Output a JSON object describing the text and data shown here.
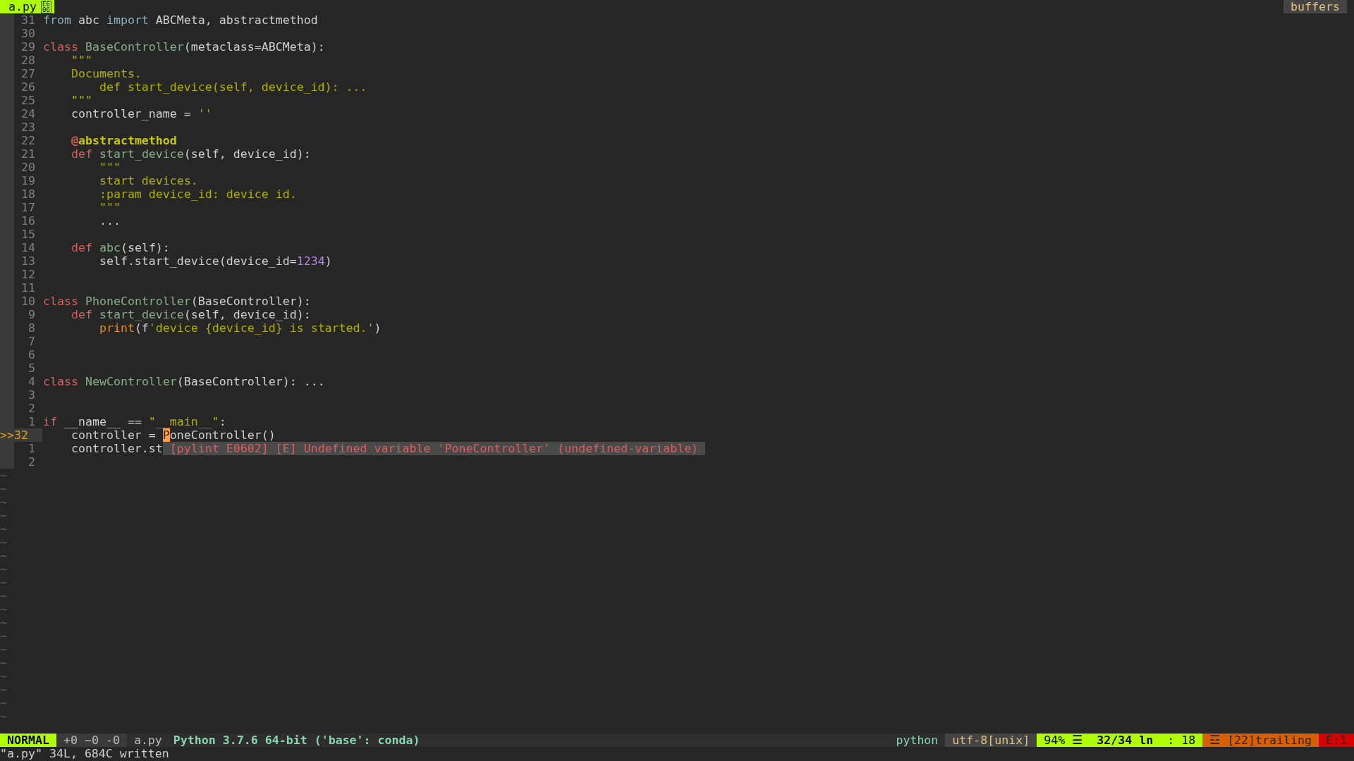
{
  "tabline": {
    "tabs": [
      {
        "label": "a.py",
        "selected": true,
        "glyph": [
          "E6",
          "06"
        ]
      }
    ],
    "right_label": "buffers"
  },
  "lines": [
    {
      "number": "31",
      "current": false,
      "segments": [
        {
          "kind": "import",
          "text": "from"
        },
        {
          "kind": "plain",
          "text": " abc "
        },
        {
          "kind": "import",
          "text": "import"
        },
        {
          "kind": "plain",
          "text": " ABCMeta, abstractmethod"
        }
      ]
    },
    {
      "number": "30",
      "current": false
    },
    {
      "number": "29",
      "current": false,
      "segments": [
        {
          "kind": "keyword",
          "text": "class "
        },
        {
          "kind": "name",
          "text": "BaseController"
        },
        {
          "kind": "plain",
          "text": "(metaclass=ABCMeta):"
        }
      ]
    },
    {
      "number": "28",
      "current": false,
      "segments": [
        {
          "kind": "string",
          "text": "    \"\"\""
        }
      ]
    },
    {
      "number": "27",
      "current": false,
      "segments": [
        {
          "kind": "string",
          "text": "    Documents."
        }
      ]
    },
    {
      "number": "26",
      "current": false,
      "segments": [
        {
          "kind": "string",
          "text": "        def start_device(self, device_id): ..."
        }
      ]
    },
    {
      "number": "25",
      "current": false,
      "segments": [
        {
          "kind": "string",
          "text": "    \"\"\""
        }
      ]
    },
    {
      "number": "24",
      "current": false,
      "segments": [
        {
          "kind": "plain",
          "text": "    controller_name = "
        },
        {
          "kind": "string",
          "text": "''"
        }
      ]
    },
    {
      "number": "23",
      "current": false
    },
    {
      "number": "22",
      "current": false,
      "segments": [
        {
          "kind": "decorator_mark",
          "text": "    @"
        },
        {
          "kind": "decorator",
          "text": "abstractmethod"
        }
      ]
    },
    {
      "number": "21",
      "current": false,
      "segments": [
        {
          "kind": "keyword",
          "text": "    def "
        },
        {
          "kind": "name",
          "text": "start_device"
        },
        {
          "kind": "plain",
          "text": "(self, device_id):"
        }
      ]
    },
    {
      "number": "20",
      "current": false,
      "segments": [
        {
          "kind": "string",
          "text": "        \"\"\""
        }
      ]
    },
    {
      "number": "19",
      "current": false,
      "segments": [
        {
          "kind": "string",
          "text": "        start devices."
        }
      ]
    },
    {
      "number": "18",
      "current": false,
      "segments": [
        {
          "kind": "string",
          "text": "        :param device_id: device id."
        }
      ]
    },
    {
      "number": "17",
      "current": false,
      "segments": [
        {
          "kind": "string",
          "text": "        \"\"\""
        }
      ]
    },
    {
      "number": "16",
      "current": false,
      "segments": [
        {
          "kind": "plain",
          "text": "        ..."
        }
      ]
    },
    {
      "number": "15",
      "current": false
    },
    {
      "number": "14",
      "current": false,
      "segments": [
        {
          "kind": "keyword",
          "text": "    def "
        },
        {
          "kind": "name",
          "text": "abc"
        },
        {
          "kind": "plain",
          "text": "(self):"
        }
      ]
    },
    {
      "number": "13",
      "current": false,
      "segments": [
        {
          "kind": "plain",
          "text": "        self.start_device(device_id="
        },
        {
          "kind": "number",
          "text": "1234"
        },
        {
          "kind": "plain",
          "text": ")"
        }
      ]
    },
    {
      "number": "12",
      "current": false
    },
    {
      "number": "11",
      "current": false
    },
    {
      "number": "10",
      "current": false,
      "segments": [
        {
          "kind": "keyword",
          "text": "class "
        },
        {
          "kind": "name",
          "text": "PhoneController"
        },
        {
          "kind": "plain",
          "text": "(BaseController):"
        }
      ]
    },
    {
      "number": "9",
      "current": false,
      "segments": [
        {
          "kind": "keyword",
          "text": "    def "
        },
        {
          "kind": "name",
          "text": "start_device"
        },
        {
          "kind": "plain",
          "text": "(self, device_id):"
        }
      ]
    },
    {
      "number": "8",
      "current": false,
      "segments": [
        {
          "kind": "builtin",
          "text": "        print"
        },
        {
          "kind": "plain",
          "text": "(f"
        },
        {
          "kind": "string",
          "text": "'device {device_id} is started.'"
        },
        {
          "kind": "plain",
          "text": ")"
        }
      ]
    },
    {
      "number": "7",
      "current": false
    },
    {
      "number": "6",
      "current": false
    },
    {
      "number": "5",
      "current": false
    },
    {
      "number": "4",
      "current": false,
      "segments": [
        {
          "kind": "keyword",
          "text": "class "
        },
        {
          "kind": "name",
          "text": "NewController"
        },
        {
          "kind": "plain",
          "text": "(BaseController): ..."
        }
      ]
    },
    {
      "number": "3",
      "current": false
    },
    {
      "number": "2",
      "current": false
    },
    {
      "number": "1",
      "current": false,
      "segments": [
        {
          "kind": "keyword",
          "text": "if"
        },
        {
          "kind": "plain",
          "text": " __name__ == "
        },
        {
          "kind": "string",
          "text": "\"__main__\""
        },
        {
          "kind": "plain",
          "text": ":"
        }
      ]
    },
    {
      "sign": ">>",
      "number": "32",
      "current": true,
      "segments": [
        {
          "kind": "plain",
          "text": "    controller = "
        },
        {
          "kind": "cursor",
          "text": "P"
        },
        {
          "kind": "plain",
          "text": "oneController()"
        }
      ]
    },
    {
      "number": "1",
      "current": false,
      "segments": [
        {
          "kind": "plain",
          "text": "    controller.st"
        }
      ],
      "diagnostic": "[pylint E0602] [E] Undefined variable 'PoneController' (undefined-variable)"
    },
    {
      "number": "2",
      "current": false
    }
  ],
  "tildes": [
    "~",
    "~",
    "~",
    "~",
    "~",
    "~",
    "~",
    "~",
    "~",
    "~",
    "~",
    "~",
    "~",
    "~",
    "~",
    "~",
    "~",
    "~",
    "~"
  ],
  "status_line": {
    "mode": "NORMAL",
    "diff": "+0 ~0 -0",
    "file": "a.py",
    "interpreter": "Python 3.7.6 64-bit ('base': conda)",
    "filetype": "python",
    "encoding": "utf-8[unix]",
    "percent": "94% ☰",
    "position": "32/34 ln",
    "column": ": 18",
    "warnings": "☲ [22]trailing",
    "errors": "E:1"
  },
  "command_line": "\"a.py\" 34L, 684C written"
}
